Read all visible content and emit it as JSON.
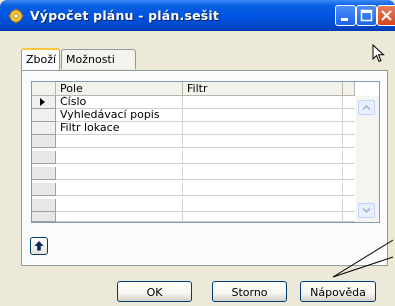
{
  "window": {
    "title": "Výpočet plánu - plán.sešit",
    "icon": "gear-icon",
    "controls": {
      "minimize": "minimize-icon",
      "maximize": "maximize-icon",
      "close": "close-icon"
    },
    "colors": {
      "titlebar": "#0054e3",
      "close_button": "#d5451d",
      "tab_accent": "#ffc83c"
    }
  },
  "tabs": [
    {
      "label": "Zboží",
      "active": true
    },
    {
      "label": "Možnosti",
      "active": false
    }
  ],
  "grid": {
    "columns": [
      "Pole",
      "Filtr"
    ],
    "rows": [
      {
        "field": "Číslo",
        "filter": "",
        "current": true
      },
      {
        "field": "Vyhledávací popis",
        "filter": "",
        "current": false
      },
      {
        "field": "Filtr lokace",
        "filter": "",
        "current": false
      },
      {
        "field": "",
        "filter": "",
        "current": false
      },
      {
        "field": "",
        "filter": "",
        "current": false
      },
      {
        "field": "",
        "filter": "",
        "current": false
      },
      {
        "field": "",
        "filter": "",
        "current": false
      },
      {
        "field": "",
        "filter": "",
        "current": false
      },
      {
        "field": "",
        "filter": "",
        "current": false
      }
    ]
  },
  "buttons": {
    "ok": "OK",
    "cancel": "Storno",
    "help": "Nápověda"
  }
}
